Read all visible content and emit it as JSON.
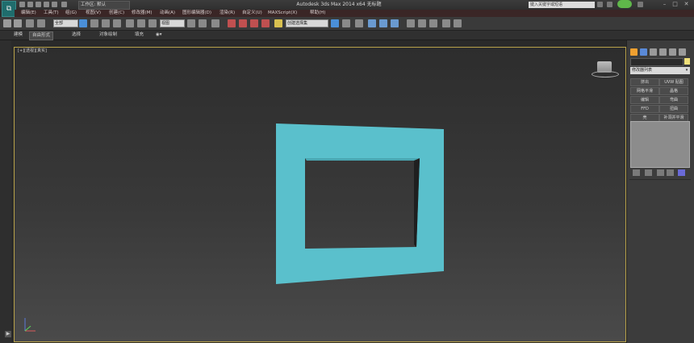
{
  "app": {
    "title": "Autodesk 3ds Max  2014 x64      无标题",
    "workspace": "工作区: 默认",
    "search_placeholder": "键入关键字或短语"
  },
  "menu": [
    "编辑(E)",
    "工具(T)",
    "组(G)",
    "视图(V)",
    "创建(C)",
    "修改器(M)",
    "动画(A)",
    "图形编辑器(D)",
    "渲染(R)",
    "自定义(U)",
    "MAXScript(X)",
    "帮助(H)"
  ],
  "toolbar": {
    "selection_filter": "全部",
    "ref_coord": "视图",
    "named_selection": "创建选择集"
  },
  "ribbon": {
    "tabs": [
      "建模",
      "自由形式",
      "选择",
      "对象绘制",
      "填充"
    ]
  },
  "viewport": {
    "label": "[+][透视][真实]"
  },
  "command_panel": {
    "modifier_list": "修改器列表",
    "buttons": [
      "挤出",
      "UVW 贴图",
      "网格平滑",
      "晶格",
      "编辑",
      "弯曲",
      "FFD",
      "扭曲",
      "壳",
      "补洞并平滑"
    ]
  },
  "colors": {
    "accent": "#5ac0cc",
    "menubar": "#3a2626",
    "viewport_border": "#b8a24a"
  }
}
